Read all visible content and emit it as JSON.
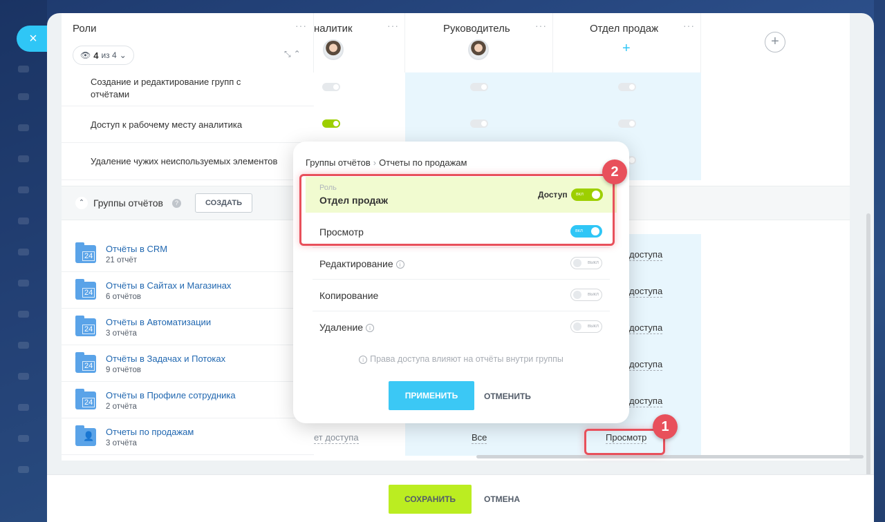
{
  "close_icon": "×",
  "header": {
    "roles_title": "Роли",
    "roles_filter": {
      "count": "4",
      "of": "из 4"
    },
    "columns": [
      {
        "title": "налитик",
        "avatar": "analyst-avatar"
      },
      {
        "title": "Руководитель",
        "avatar": "manager-avatar"
      },
      {
        "title": "Отдел продаж",
        "avatar": "plus-icon"
      }
    ],
    "dots": "···",
    "add_role_icon": "+"
  },
  "permissions": [
    {
      "label": "Создание и редактирование групп с отчётами",
      "analyst": false,
      "manager": false,
      "sales": false
    },
    {
      "label": "Доступ к рабочему месту аналитика",
      "analyst": true,
      "manager": false,
      "sales": false
    },
    {
      "label": "Удаление чужих неиспользуемых элементов",
      "analyst": false,
      "manager": false,
      "sales": false
    }
  ],
  "groups": {
    "title": "Группы отчётов",
    "create_label": "СОЗДАТЬ",
    "reports": [
      {
        "name": "Отчёты в CRM",
        "count": "21 отчёт",
        "access": "доступа"
      },
      {
        "name": "Отчёты в Сайтах и Магазинах",
        "count": "6 отчётов",
        "access": "доступа"
      },
      {
        "name": "Отчёты в Автоматизации",
        "count": "3 отчёта",
        "access": "доступа"
      },
      {
        "name": "Отчёты в Задачах и Потоках",
        "count": "9 отчётов",
        "access": "доступа"
      },
      {
        "name": "Отчёты в Профиле сотрудника",
        "count": "2 отчёта",
        "access": "доступа"
      },
      {
        "name": "Отчеты по продажам",
        "count": "3 отчёта",
        "analyst_access": "ет доступа",
        "manager_access": "Все",
        "sales_access": "Просмотр"
      }
    ],
    "folder_label": "24"
  },
  "popup": {
    "breadcrumb": [
      "Группы отчётов",
      "Отчеты по продажам"
    ],
    "role_caption": "Роль",
    "role_value": "Отдел продаж",
    "access_label": "Доступ",
    "switch_on": "вкл",
    "switch_off": "выкл",
    "options": [
      {
        "label": "Просмотр",
        "state": "on"
      },
      {
        "label": "Редактирование",
        "state": "off"
      },
      {
        "label": "Копирование",
        "state": "off"
      },
      {
        "label": "Удаление",
        "state": "off"
      }
    ],
    "note": "Права доступа влияют на отчёты внутри группы",
    "apply": "ПРИМЕНИТЬ",
    "cancel": "ОТМЕНИТЬ"
  },
  "footer": {
    "save": "СОХРАНИТЬ",
    "cancel": "ОТМЕНА"
  },
  "annotations": {
    "badge1": "1",
    "badge2": "2",
    "color": "#e8505b"
  },
  "colors": {
    "accent_blue": "#2fc6f6",
    "accent_green": "#bbed21",
    "toggle_green": "#9dcf00",
    "link": "#2067b0"
  }
}
